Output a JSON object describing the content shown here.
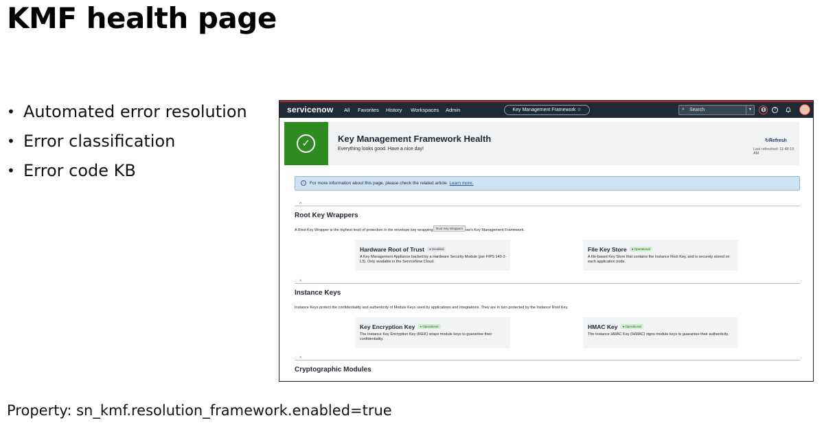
{
  "slide": {
    "title": "KMF health page",
    "bullets": [
      "Automated error resolution",
      "Error classification",
      "Error code KB"
    ],
    "property": "Property: sn_kmf.resolution_framework.enabled=true"
  },
  "topbar": {
    "logo": "servicenow",
    "nav": [
      "All",
      "Favorites",
      "History",
      "Workspaces",
      "Admin"
    ],
    "app_pill": "Key Management Framework ☆",
    "search_label": "Search",
    "search_icon": "⌕",
    "dropdown_icon": "▾",
    "help_icon": "?",
    "bell_icon": "🔔"
  },
  "hero": {
    "title": "Key Management Framework Health",
    "subtitle": "Everything looks good. Have a nice day!",
    "check_icon": "✓",
    "refresh_label": "↻Refresh",
    "last_refreshed": "Last refreshed: 11:48:19 AM"
  },
  "info_banner": {
    "icon": "i",
    "text": "For more information about this page, please check the related article.",
    "link": "Learn more."
  },
  "sections": {
    "root_key_wrappers": {
      "title": "Root Key Wrappers",
      "desc": "A Root Key Wrapper is the highest level of protection in the envelope key wrapping design of ServiceNow's Key Management Framework.",
      "tooltip": "Root Key Wrappers",
      "cards": [
        {
          "title": "Hardware Root of Trust",
          "badge": "● Disabled",
          "desc": "A Key Management Appliance backed by a Hardware Security Module (per FIPS 140-2-L3). Only available in the ServiceNow Cloud."
        },
        {
          "title": "File Key Store",
          "badge": "● Operational",
          "desc": "A file-based Key Store that contains the Instance Root Key, and is securely stored on each application node."
        }
      ]
    },
    "instance_keys": {
      "title": "Instance Keys",
      "desc": "Instance Keys protect the confidentiality and authenticity of Module Keys used by applications and integrations. They are in turn protected by the Instance Root Key.",
      "cards": [
        {
          "title": "Key Encryption Key",
          "badge": "● Operational",
          "desc": "The Instance Key Encryption Key (IKEK) wraps module keys to guarantee their confidentiality."
        },
        {
          "title": "HMAC Key",
          "badge": "● Operational",
          "desc": "The Instance HMAC Key (IHMAC) signs module keys to guarantee their authenticity."
        }
      ]
    },
    "crypto_modules": {
      "title": "Cryptographic Modules"
    }
  },
  "colors": {
    "topbar": "#1f2a35",
    "success": "#2e8b22",
    "info_bg": "#cfe2f3"
  }
}
